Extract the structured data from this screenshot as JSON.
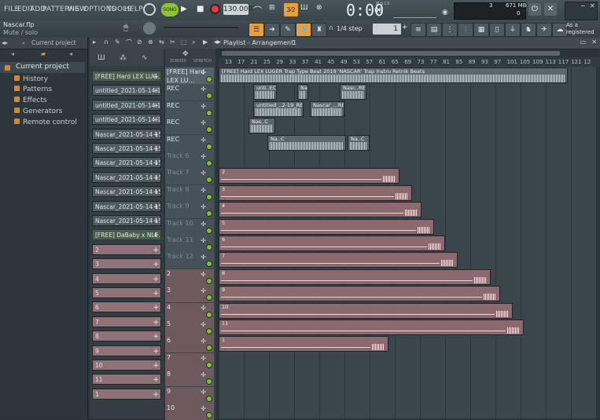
{
  "menu": [
    "FILE",
    "EDIT",
    "ADD",
    "PATTERNS",
    "VIEW",
    "OPTIONS",
    "TOOLS",
    "HELP"
  ],
  "transport": {
    "mode": "SONG",
    "tempo": "130.000",
    "time": "0:00",
    "time_ms": "00",
    "time_unit": "M:S:CS"
  },
  "monitor": {
    "cpu_label": "3",
    "mem_label": "671 MB",
    "voices": "0"
  },
  "project": {
    "file": "Nascar.flp",
    "hint": "Mute / solo"
  },
  "snap": {
    "label": "1/4 step"
  },
  "pattern_num": "1",
  "registered": "As a registered",
  "playlist": {
    "title": "Playlist - Arrangement",
    "pattern": "1"
  },
  "browser": {
    "header": "Current project",
    "root": "Current project",
    "items": [
      "History",
      "Patterns",
      "Effects",
      "Generators",
      "Remote control"
    ]
  },
  "ruler": [
    "13",
    "17",
    "21",
    "25",
    "29",
    "33",
    "37",
    "41",
    "45",
    "49",
    "53",
    "57",
    "61",
    "65",
    "69",
    "73",
    "77",
    "81",
    "85",
    "89",
    "93",
    "97",
    "101",
    "105",
    "109",
    "113",
    "117",
    "121",
    "12"
  ],
  "channels": [
    {
      "label": "[FREE] Hard LEX LUG…",
      "type": "green"
    },
    {
      "label": "untitled_2021-05-14 14-…",
      "type": "audio"
    },
    {
      "label": "untitled_2021-05-14 14-…",
      "type": "audio"
    },
    {
      "label": "untitled_2021-05-14 15-…",
      "type": "audio"
    },
    {
      "label": "Nascar_2021-05-14 15-0…",
      "type": "audio"
    },
    {
      "label": "Nascar_2021-05-14 15-0…",
      "type": "audio"
    },
    {
      "label": "Nascar_2021-05-14 15-0…",
      "type": "audio"
    },
    {
      "label": "Nascar_2021-05-14 15-1…",
      "type": "audio"
    },
    {
      "label": "Nascar_2021-05-14 15-1…",
      "type": "audio"
    },
    {
      "label": "Nascar_2021-05-14 15-1…",
      "type": "audio"
    },
    {
      "label": "Nascar_2021-05-14 15-1…",
      "type": "audio"
    },
    {
      "label": "[FREE] DaBaby x NLE…",
      "type": "green"
    },
    {
      "label": "2",
      "type": "pat"
    },
    {
      "label": "3",
      "type": "pat"
    },
    {
      "label": "4",
      "type": "pat"
    },
    {
      "label": "5",
      "type": "pat"
    },
    {
      "label": "6",
      "type": "pat"
    },
    {
      "label": "7",
      "type": "pat"
    },
    {
      "label": "8",
      "type": "pat"
    },
    {
      "label": "9",
      "type": "pat"
    },
    {
      "label": "10",
      "type": "pat"
    },
    {
      "label": "11",
      "type": "pat"
    },
    {
      "label": "1",
      "type": "pat"
    }
  ],
  "tracks": [
    "[FREE] Hard LEX LU…",
    "REC",
    "REC",
    "REC",
    "REC",
    "Track 6",
    "Track 7",
    "Track 8",
    "Track 9",
    "Track 10",
    "Track 11",
    "Track 12",
    "2",
    "3",
    "4",
    "5",
    "6",
    "7",
    "8",
    "9",
    "10"
  ],
  "clips": {
    "main": "[FREE] Hard LEX LUGER Trap Type Beat 2019 'NASCAR' Trap Instru Retnik Beats",
    "rec1a": "unti..EC",
    "rec1b": "Nasc..REC",
    "rec2a": "untitled_..2-19_REC",
    "rec2b": "Nascar_...REC",
    "rec3": "Nas..C",
    "rec4": "Na..C",
    "patterns": [
      "2",
      "3",
      "4",
      "5",
      "6",
      "7",
      "8",
      "9",
      "10",
      "11",
      "1"
    ]
  }
}
